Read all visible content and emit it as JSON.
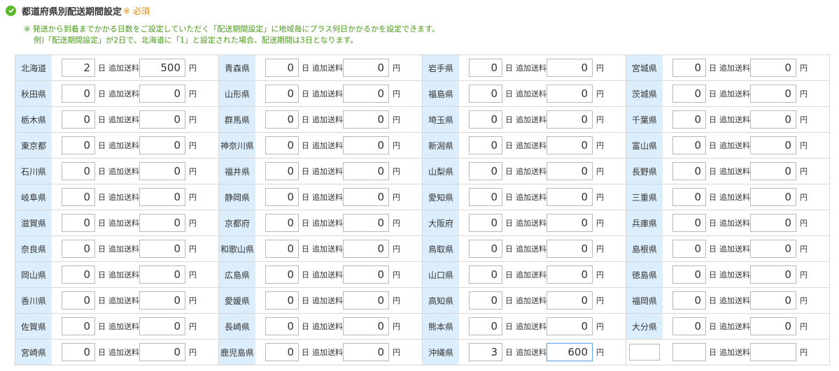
{
  "header": {
    "title": "都道府県別配送期間設定",
    "required": "※ 必須"
  },
  "notes": {
    "line1": "※ 発送から到着までかかる日数をご設定していただく「配送期間設定」に地域毎にプラス何日かかるかを設定できます。",
    "line2": "例)「配送期間設定」が2日で、北海道に「1」と設定された場合、配送期間は3日となります。"
  },
  "labels": {
    "day_unit": "日",
    "fee_label": "追加送料",
    "yen_unit": "円"
  },
  "prefectures": [
    {
      "name": "北海道",
      "days": "2",
      "fee": "500"
    },
    {
      "name": "青森県",
      "days": "0",
      "fee": "0"
    },
    {
      "name": "岩手県",
      "days": "0",
      "fee": "0"
    },
    {
      "name": "宮城県",
      "days": "0",
      "fee": "0"
    },
    {
      "name": "秋田県",
      "days": "0",
      "fee": "0"
    },
    {
      "name": "山形県",
      "days": "0",
      "fee": "0"
    },
    {
      "name": "福島県",
      "days": "0",
      "fee": "0"
    },
    {
      "name": "茨城県",
      "days": "0",
      "fee": "0"
    },
    {
      "name": "栃木県",
      "days": "0",
      "fee": "0"
    },
    {
      "name": "群馬県",
      "days": "0",
      "fee": "0"
    },
    {
      "name": "埼玉県",
      "days": "0",
      "fee": "0"
    },
    {
      "name": "千葉県",
      "days": "0",
      "fee": "0"
    },
    {
      "name": "東京都",
      "days": "0",
      "fee": "0"
    },
    {
      "name": "神奈川県",
      "days": "0",
      "fee": "0"
    },
    {
      "name": "新潟県",
      "days": "0",
      "fee": "0"
    },
    {
      "name": "富山県",
      "days": "0",
      "fee": "0"
    },
    {
      "name": "石川県",
      "days": "0",
      "fee": "0"
    },
    {
      "name": "福井県",
      "days": "0",
      "fee": "0"
    },
    {
      "name": "山梨県",
      "days": "0",
      "fee": "0"
    },
    {
      "name": "長野県",
      "days": "0",
      "fee": "0"
    },
    {
      "name": "岐阜県",
      "days": "0",
      "fee": "0"
    },
    {
      "name": "静岡県",
      "days": "0",
      "fee": "0"
    },
    {
      "name": "愛知県",
      "days": "0",
      "fee": "0"
    },
    {
      "name": "三重県",
      "days": "0",
      "fee": "0"
    },
    {
      "name": "滋賀県",
      "days": "0",
      "fee": "0"
    },
    {
      "name": "京都府",
      "days": "0",
      "fee": "0"
    },
    {
      "name": "大阪府",
      "days": "0",
      "fee": "0"
    },
    {
      "name": "兵庫県",
      "days": "0",
      "fee": "0"
    },
    {
      "name": "奈良県",
      "days": "0",
      "fee": "0"
    },
    {
      "name": "和歌山県",
      "days": "0",
      "fee": "0"
    },
    {
      "name": "鳥取県",
      "days": "0",
      "fee": "0"
    },
    {
      "name": "島根県",
      "days": "0",
      "fee": "0"
    },
    {
      "name": "岡山県",
      "days": "0",
      "fee": "0"
    },
    {
      "name": "広島県",
      "days": "0",
      "fee": "0"
    },
    {
      "name": "山口県",
      "days": "0",
      "fee": "0"
    },
    {
      "name": "徳島県",
      "days": "0",
      "fee": "0"
    },
    {
      "name": "香川県",
      "days": "0",
      "fee": "0"
    },
    {
      "name": "愛媛県",
      "days": "0",
      "fee": "0"
    },
    {
      "name": "高知県",
      "days": "0",
      "fee": "0"
    },
    {
      "name": "福岡県",
      "days": "0",
      "fee": "0"
    },
    {
      "name": "佐賀県",
      "days": "0",
      "fee": "0"
    },
    {
      "name": "長崎県",
      "days": "0",
      "fee": "0"
    },
    {
      "name": "熊本県",
      "days": "0",
      "fee": "0"
    },
    {
      "name": "大分県",
      "days": "0",
      "fee": "0"
    },
    {
      "name": "宮崎県",
      "days": "0",
      "fee": "0"
    },
    {
      "name": "鹿児島県",
      "days": "0",
      "fee": "0"
    },
    {
      "name": "沖縄県",
      "days": "3",
      "fee": "600",
      "focused": true
    },
    {
      "name": "",
      "days": "",
      "fee": "",
      "custom": true
    }
  ],
  "colors": {
    "accent_green": "#5ab82b",
    "note_green": "#4a9a1a",
    "required_orange": "#e08a00",
    "pref_bg": "#dceefb",
    "focus_border": "#6aa9e9"
  }
}
